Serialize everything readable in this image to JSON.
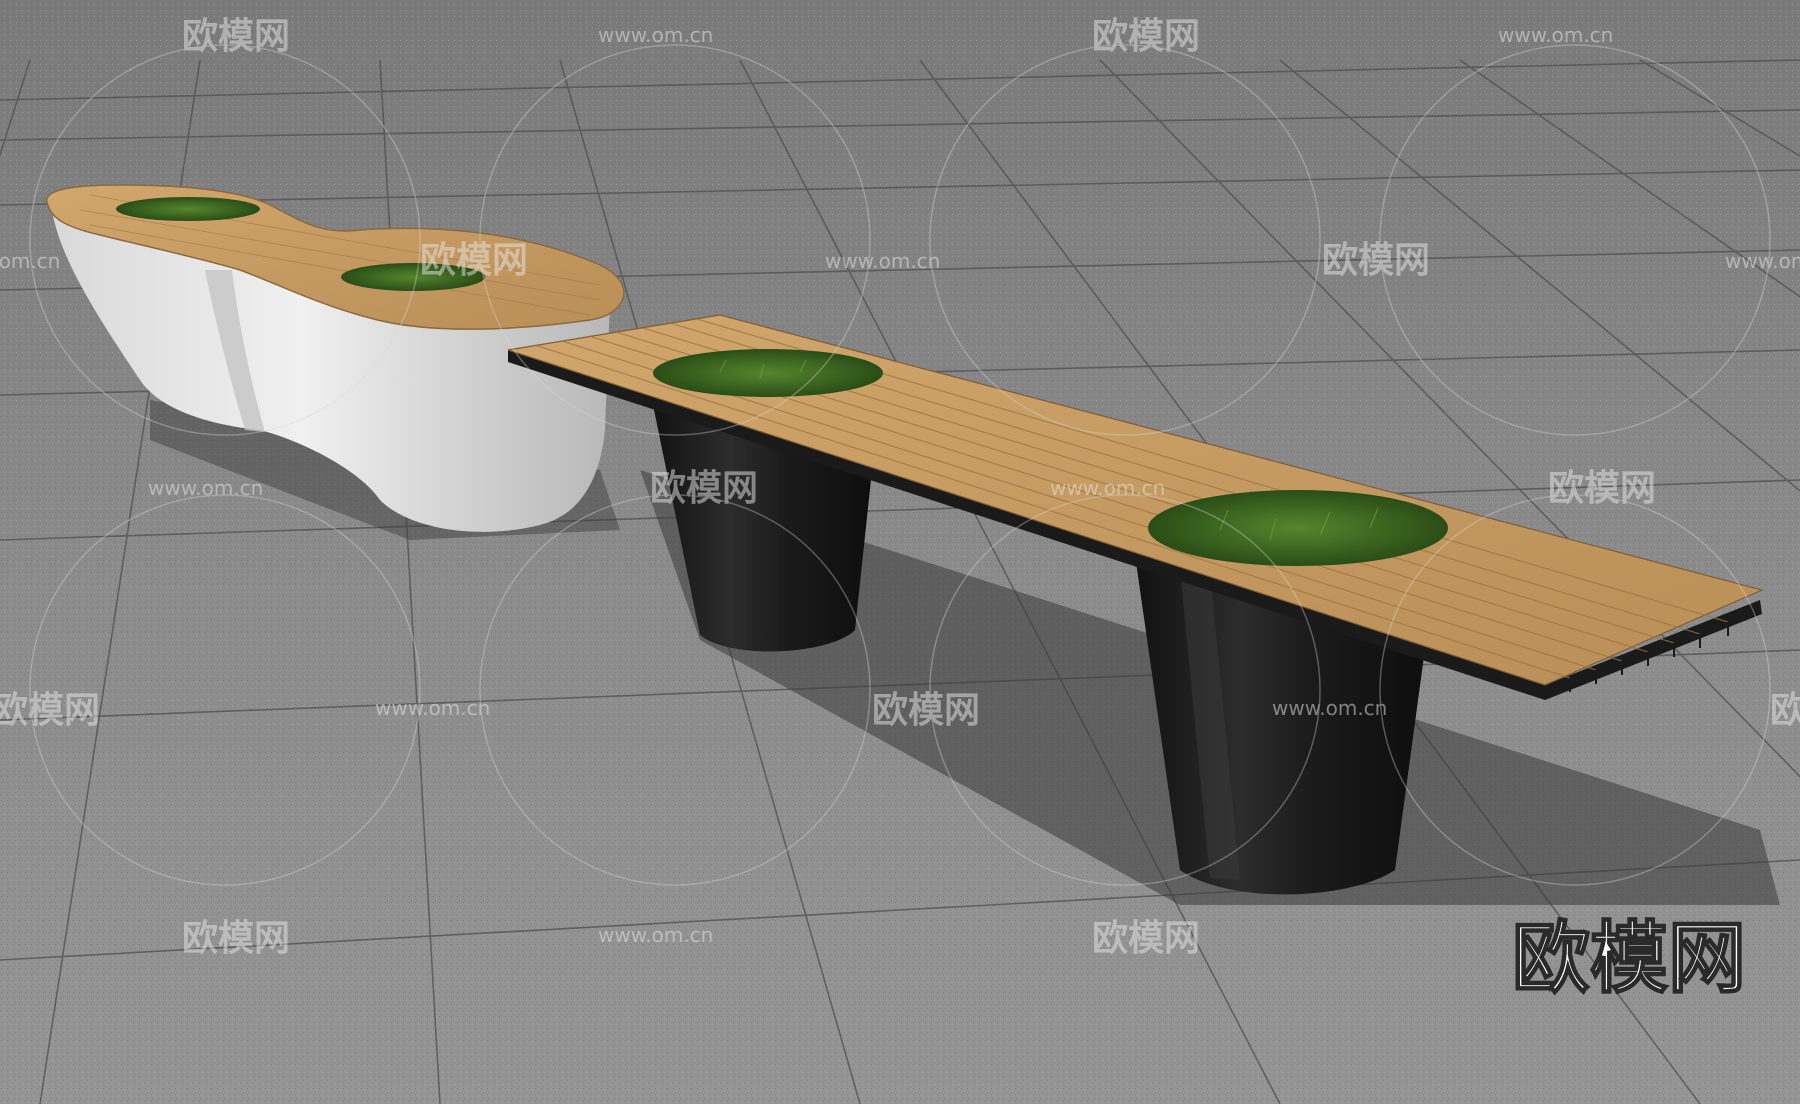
{
  "watermark": {
    "brand_text": "欧模网",
    "url_text": "www.om.cn",
    "corner_brand_text": "欧模网"
  },
  "scene": {
    "objects": [
      "paved-ground",
      "white-curved-planter-bench",
      "wooden-plank-bench-with-black-pot-legs",
      "grass-inserts"
    ],
    "colors": {
      "ground": "#8a8a8a",
      "ground_light": "#a3a3a3",
      "tile_line": "#555555",
      "wood": "#c49a63",
      "wood_dark": "#9a7443",
      "white_planter": "#e6e6e6",
      "white_planter_shade": "#bdbdbd",
      "black_pot": "#1b1b1b",
      "black_pot_highlight": "#3a3a3a",
      "grass": "#3f6b22",
      "grass_dark": "#274717",
      "shadow": "#3e3e3e"
    }
  }
}
